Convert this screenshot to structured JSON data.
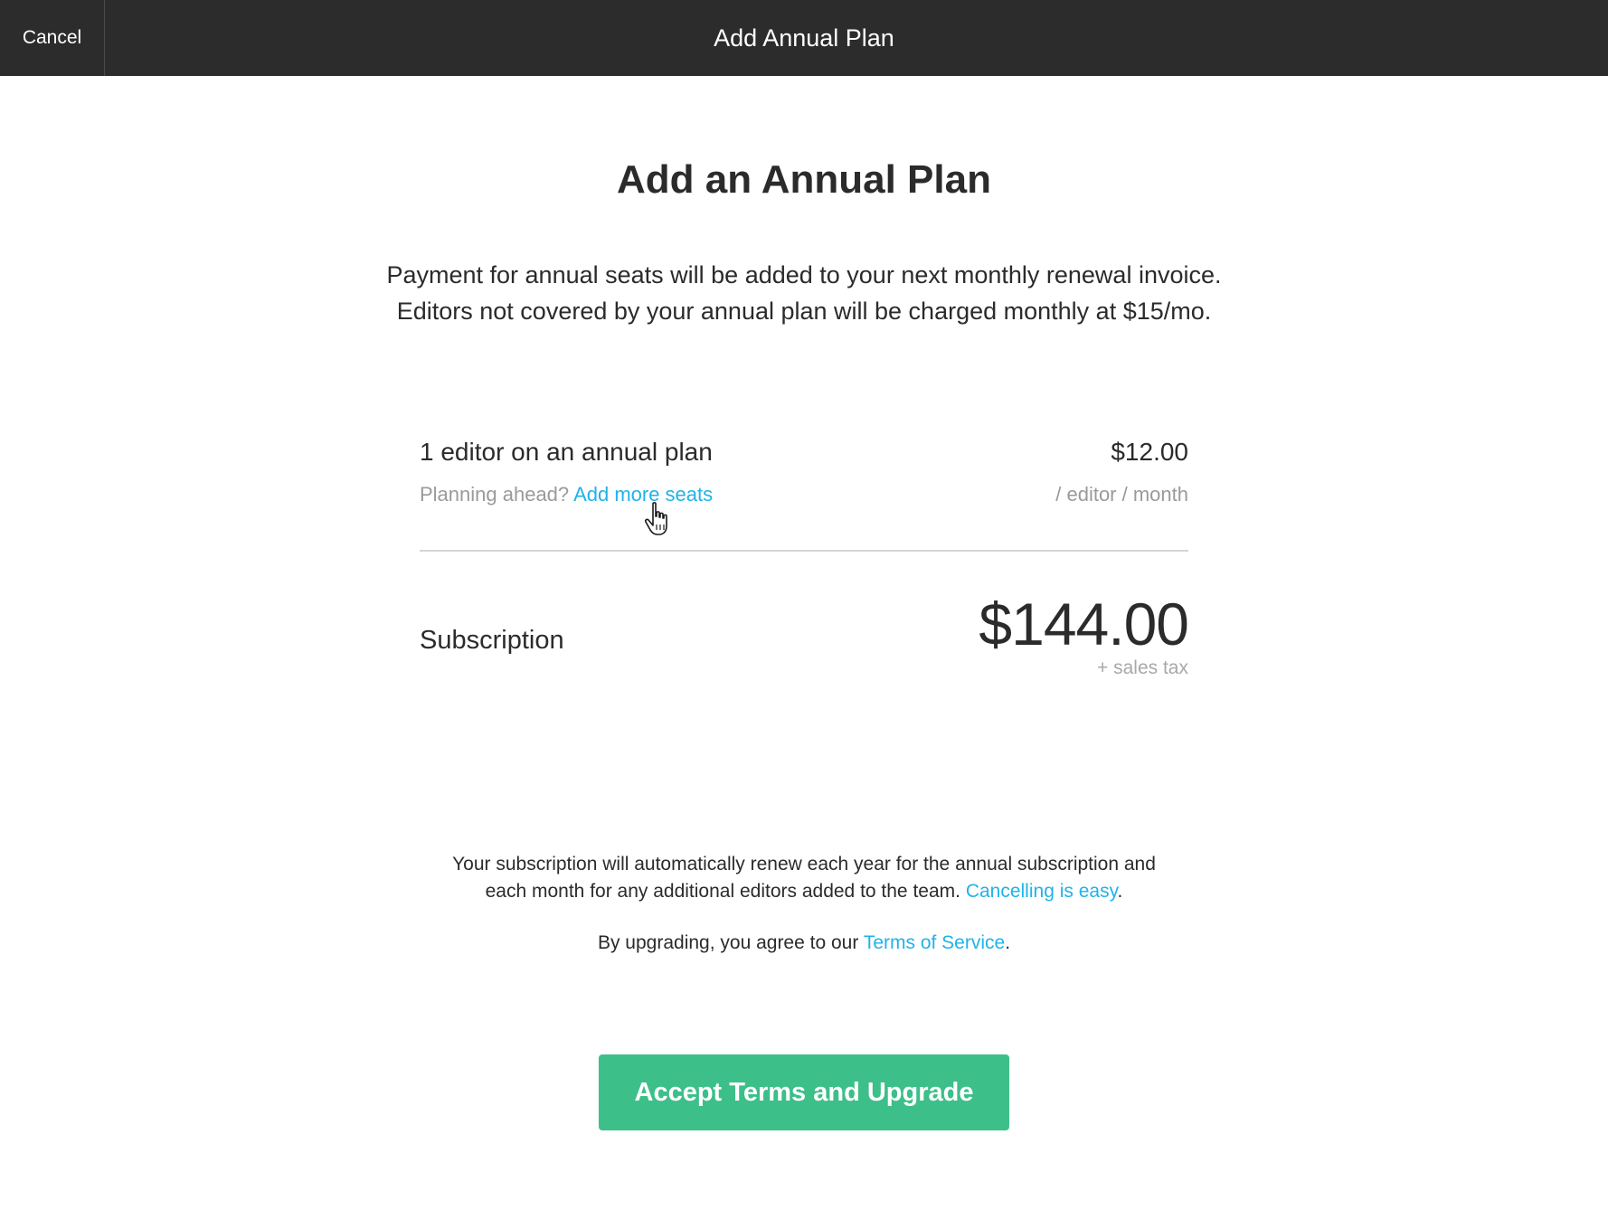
{
  "topbar": {
    "cancel_label": "Cancel",
    "title": "Add Annual Plan"
  },
  "main": {
    "heading": "Add an Annual Plan",
    "intro_line1": "Payment for annual seats will be added to your next monthly renewal invoice.",
    "intro_line2": "Editors not covered by your annual plan will be charged monthly at $15/mo."
  },
  "plan": {
    "label": "1 editor on an annual plan",
    "price": "$12.00",
    "planning_prefix": "Planning ahead?",
    "add_seats_link": "Add more seats",
    "unit": "/ editor / month"
  },
  "subscription": {
    "label": "Subscription",
    "price": "$144.00",
    "tax_note": "+ sales tax"
  },
  "legal": {
    "renew_line1": "Your subscription will automatically renew each year for the annual subscription and",
    "renew_line2": "each month for any additional editors added to the team.",
    "cancelling_link": "Cancelling is easy",
    "period": ".",
    "tos_prefix": "By upgrading, you agree to our",
    "tos_link": "Terms of Service",
    "tos_suffix": "."
  },
  "actions": {
    "accept_label": "Accept Terms and Upgrade"
  },
  "colors": {
    "topbar_bg": "#2c2c2c",
    "link": "#1fb3e8",
    "accept_button": "#3dbf8a"
  },
  "icons": {
    "cursor": "hand-pointer-icon"
  }
}
